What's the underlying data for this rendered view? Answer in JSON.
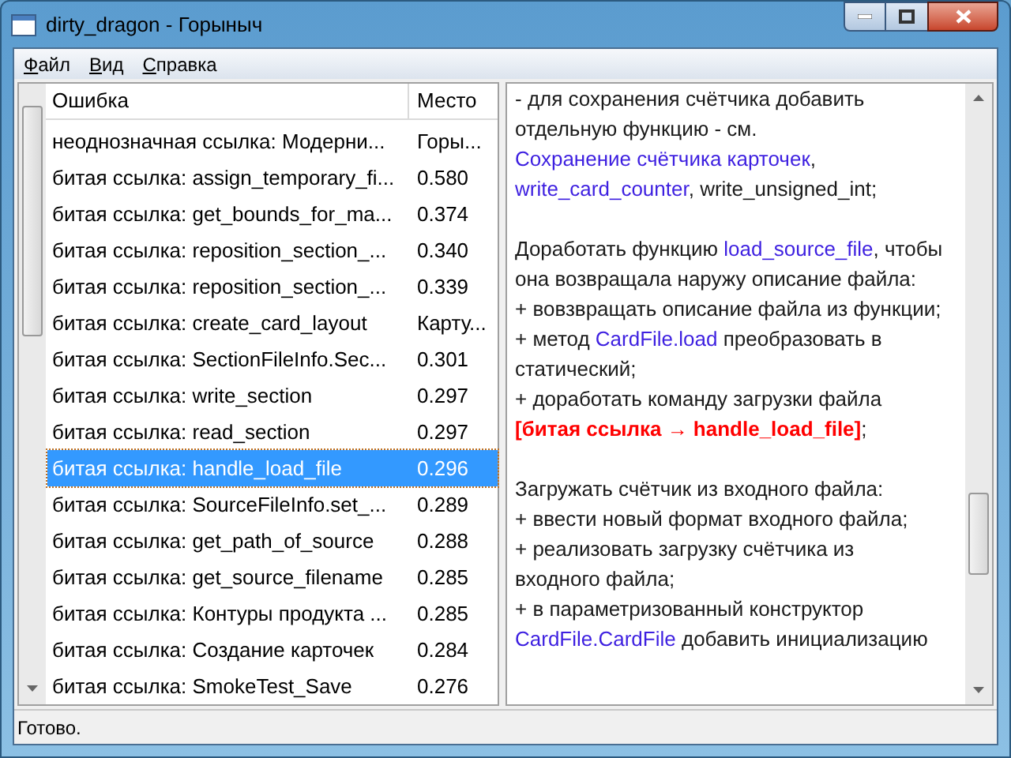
{
  "window": {
    "title": "dirty_dragon - Горыныч"
  },
  "menu": [
    {
      "label": "Файл"
    },
    {
      "label": "Вид"
    },
    {
      "label": "Справка"
    }
  ],
  "table": {
    "columns": [
      "Ошибка",
      "Место"
    ],
    "rows": [
      {
        "error": "неоднозначная ссылка: Модерни...",
        "place": "Горы...",
        "selected": false
      },
      {
        "error": "битая ссылка: assign_temporary_fi...",
        "place": "0.580",
        "selected": false
      },
      {
        "error": "битая ссылка: get_bounds_for_ma...",
        "place": "0.374",
        "selected": false
      },
      {
        "error": "битая ссылка: reposition_section_...",
        "place": "0.340",
        "selected": false
      },
      {
        "error": "битая ссылка: reposition_section_...",
        "place": "0.339",
        "selected": false
      },
      {
        "error": "битая ссылка: create_card_layout",
        "place": "Карту...",
        "selected": false
      },
      {
        "error": "битая ссылка: SectionFileInfo.Sec...",
        "place": "0.301",
        "selected": false
      },
      {
        "error": "битая ссылка: write_section",
        "place": "0.297",
        "selected": false
      },
      {
        "error": "битая ссылка: read_section",
        "place": "0.297",
        "selected": false
      },
      {
        "error": "битая ссылка: handle_load_file",
        "place": "0.296",
        "selected": true
      },
      {
        "error": "битая ссылка: SourceFileInfo.set_...",
        "place": "0.289",
        "selected": false
      },
      {
        "error": "битая ссылка: get_path_of_source",
        "place": "0.288",
        "selected": false
      },
      {
        "error": "битая ссылка: get_source_filename",
        "place": "0.285",
        "selected": false
      },
      {
        "error": "битая ссылка: Контуры продукта ...",
        "place": "0.285",
        "selected": false
      },
      {
        "error": "битая ссылка: Создание карточек",
        "place": "0.284",
        "selected": false
      },
      {
        "error": "битая ссылка: SmokeTest_Save",
        "place": "0.276",
        "selected": false
      }
    ]
  },
  "document": {
    "blocks": [
      [
        [
          {
            "kind": "text",
            "text": "- для сохранения счётчика добавить отдельную функцию - см. "
          },
          {
            "kind": "link",
            "text": "Сохранение счётчика карточек"
          },
          {
            "kind": "text",
            "text": ", "
          },
          {
            "kind": "link",
            "text": "write_card_counter"
          },
          {
            "kind": "text",
            "text": ", write_unsigned_int;"
          }
        ]
      ],
      [
        [
          {
            "kind": "text",
            "text": "Доработать функцию "
          },
          {
            "kind": "link",
            "text": "load_source_file"
          },
          {
            "kind": "text",
            "text": ", чтобы она возвращала наружу описание файла:"
          }
        ],
        [
          {
            "kind": "text",
            "text": "+ вовзвращать описание файла из функции;"
          }
        ],
        [
          {
            "kind": "text",
            "text": "+ метод "
          },
          {
            "kind": "link",
            "text": "CardFile.load"
          },
          {
            "kind": "text",
            "text": " преобразовать в статический;"
          }
        ],
        [
          {
            "kind": "text",
            "text": "+ доработать команду загрузки файла "
          },
          {
            "kind": "broken",
            "text": "[битая ссылка → handle_load_file]"
          },
          {
            "kind": "text",
            "text": ";"
          }
        ]
      ],
      [
        [
          {
            "kind": "text",
            "text": "Загружать счётчик из входного файла:"
          }
        ],
        [
          {
            "kind": "text",
            "text": "+ ввести новый формат входного файла;"
          }
        ],
        [
          {
            "kind": "text",
            "text": "+ реализовать загрузку счётчика из входного файла;"
          }
        ],
        [
          {
            "kind": "text",
            "text": "+ в параметризованный конструктор "
          },
          {
            "kind": "link",
            "text": "CardFile.CardFile"
          },
          {
            "kind": "text",
            "text": " добавить инициализацию"
          }
        ]
      ]
    ]
  },
  "status_bar": "Готово."
}
